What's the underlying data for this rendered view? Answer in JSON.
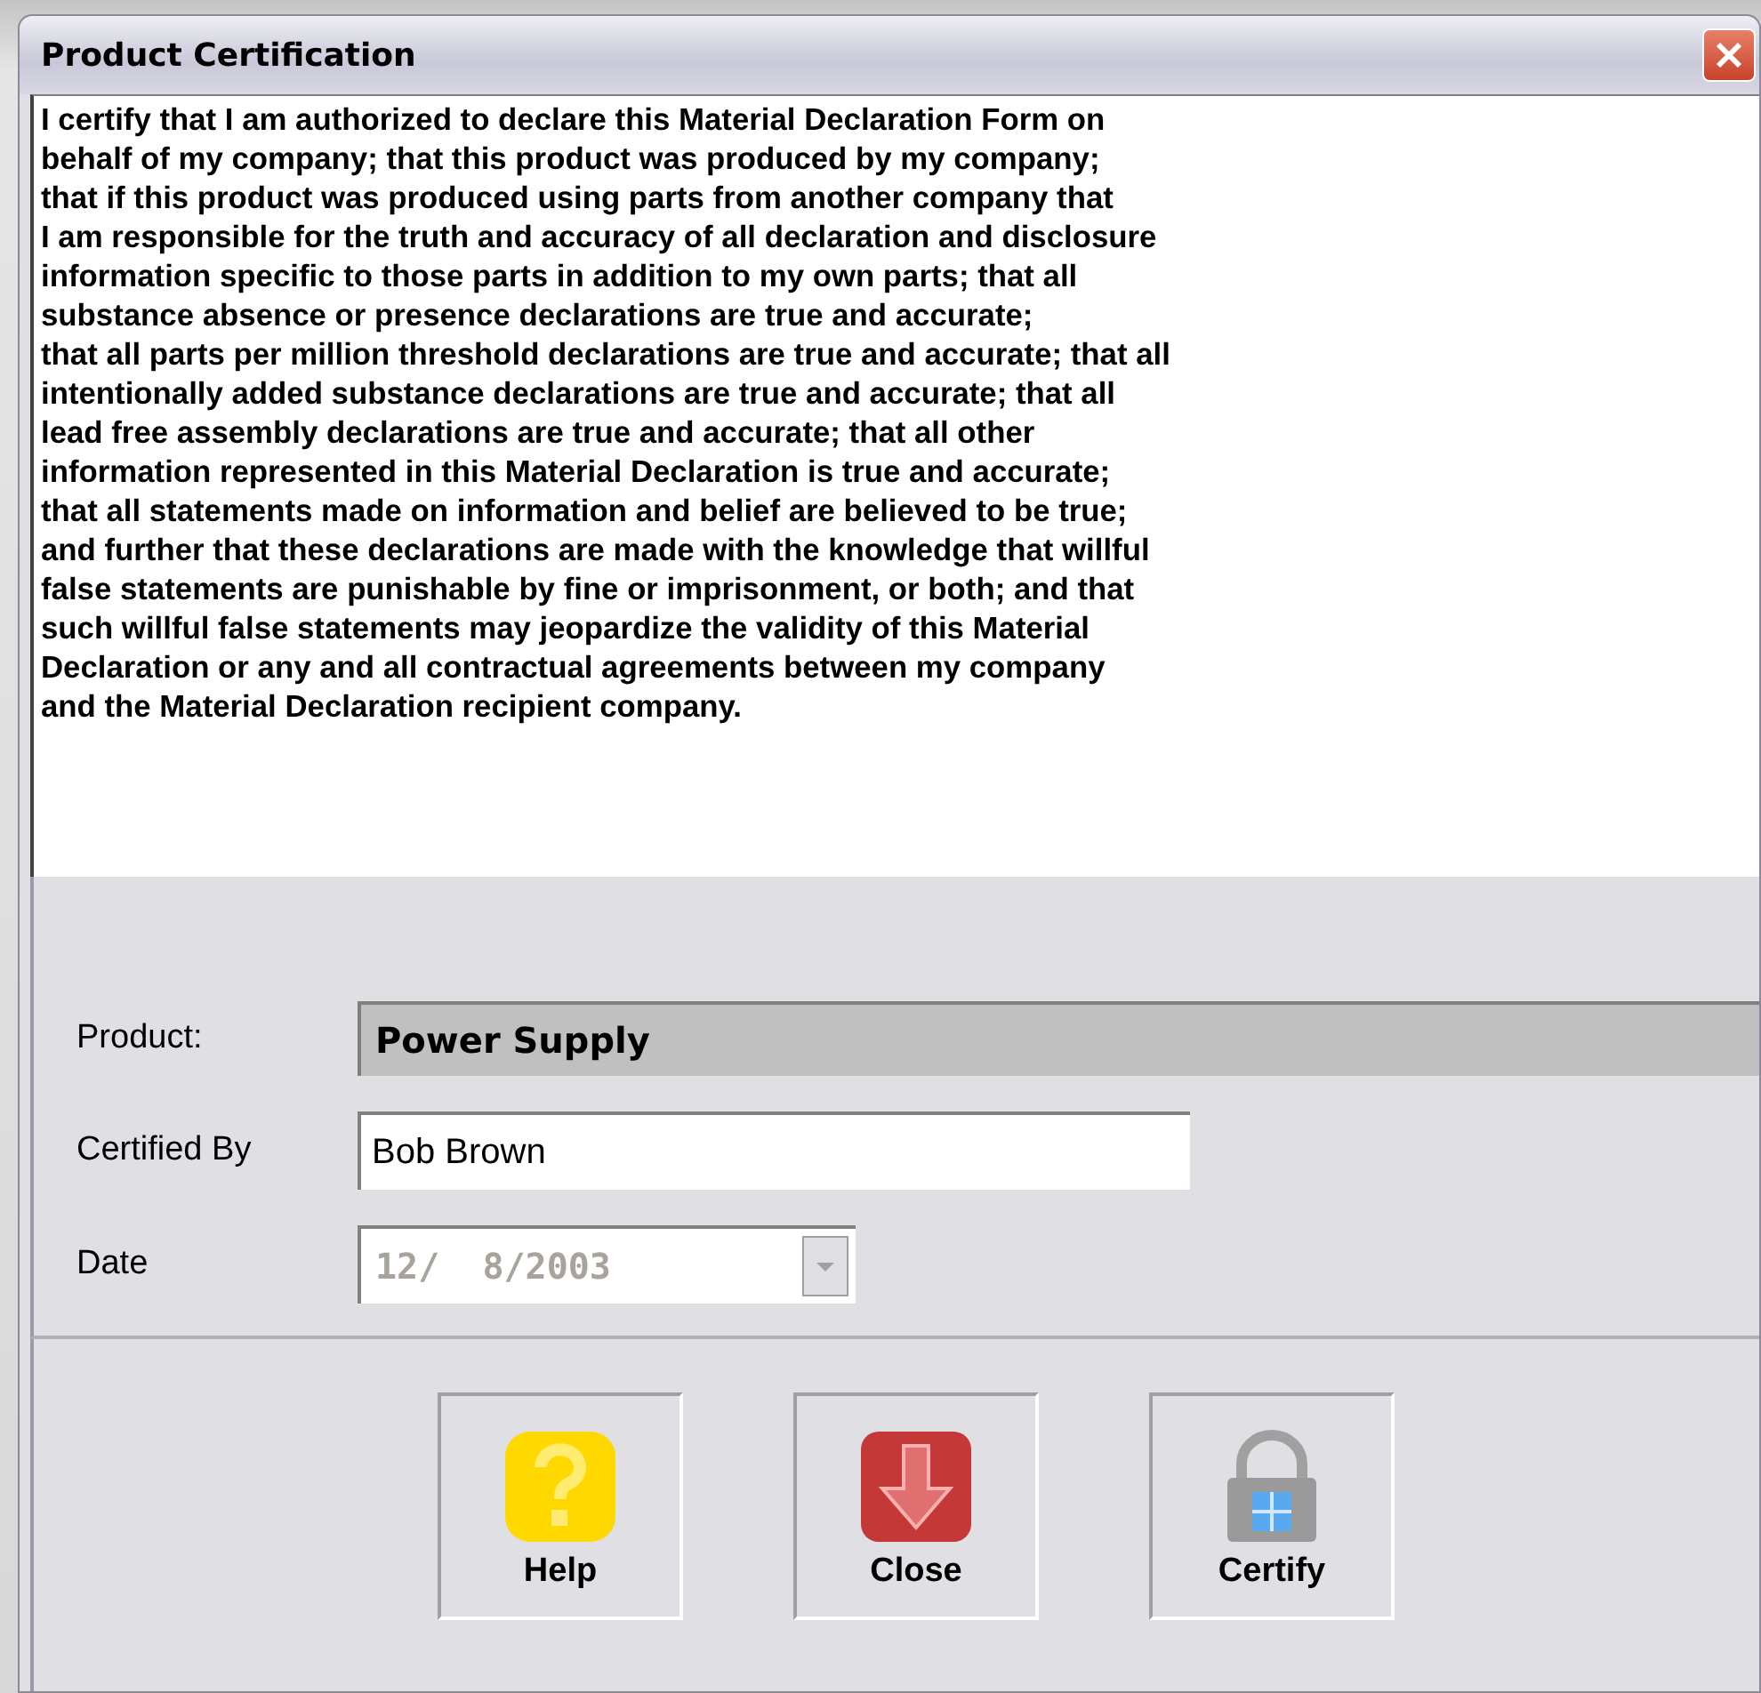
{
  "window": {
    "title": "Product Certification"
  },
  "statement": "I certify that I am authorized to declare this Material Declaration Form on\nbehalf of my company; that this product was produced by my company;\nthat if this product was produced using parts from another company that\nI am responsible for the truth and accuracy of all declaration and disclosure\ninformation specific to those parts in addition to my own parts; that all\nsubstance absence or presence declarations are true and accurate;\nthat all parts per million threshold declarations are true and accurate; that all\nintentionally added substance declarations are true and accurate; that all\nlead free assembly declarations are true and accurate; that all other\ninformation represented in this Material Declaration is true and accurate;\nthat all statements made on information and belief are believed to be true;\nand further that these declarations are made with the knowledge that willful\nfalse statements are punishable by fine or imprisonment, or both; and that\nsuch willful false statements may jeopardize the validity of this Material\nDeclaration or any and all contractual agreements between my company\nand the Material Declaration recipient company.",
  "fields": [
    {
      "kind": "readonly",
      "label": "Product:",
      "value": "Power Supply"
    },
    {
      "kind": "text",
      "label": "Certified By",
      "value": "Bob Brown"
    },
    {
      "kind": "date",
      "label": "Date",
      "value": "12/  8/2003",
      "disabled": true
    }
  ],
  "buttons": [
    {
      "kind": "help",
      "label": "Help"
    },
    {
      "kind": "close",
      "label": "Close"
    },
    {
      "kind": "certify",
      "label": "Certify"
    }
  ]
}
